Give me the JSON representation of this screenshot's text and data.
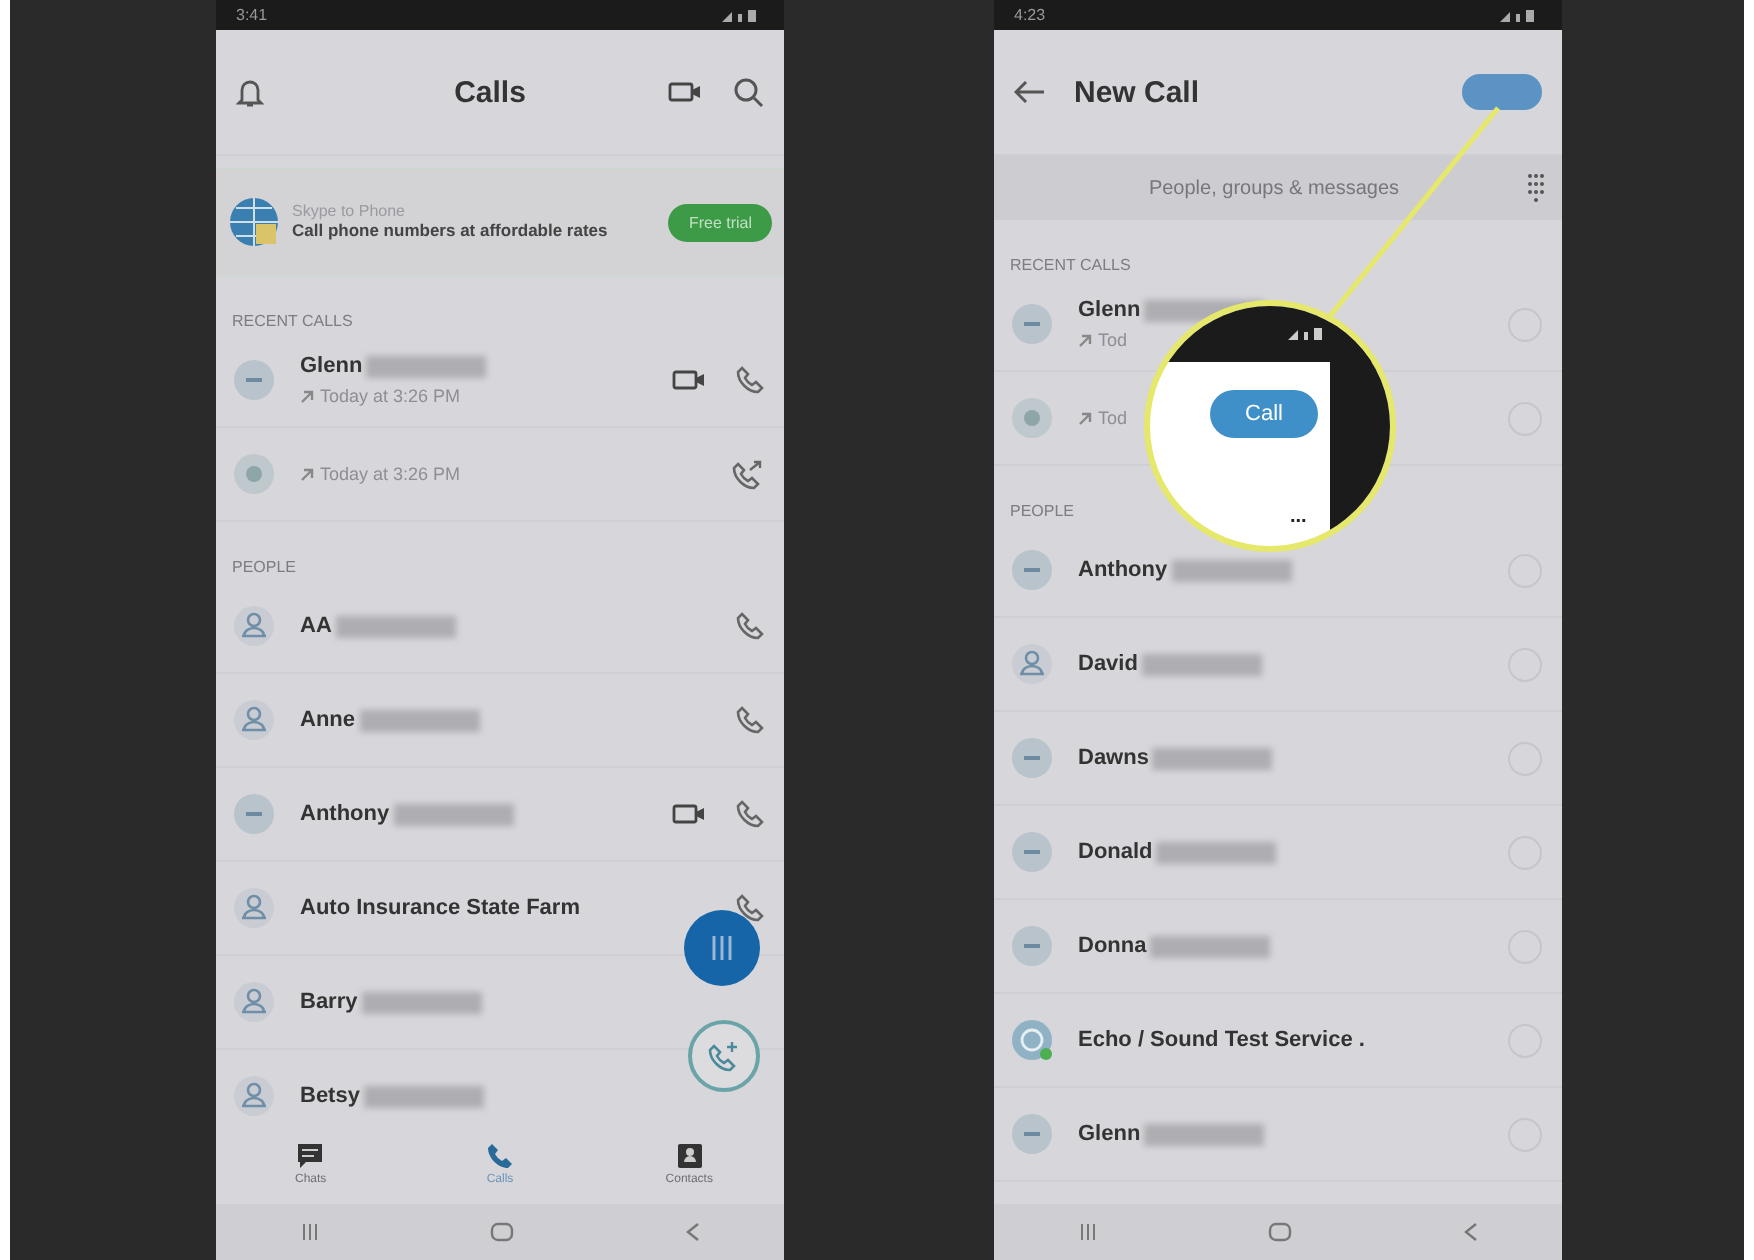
{
  "left_phone": {
    "status_bar": {
      "time": "3:41"
    },
    "header": {
      "title": "Calls"
    },
    "promo": {
      "title": "Skype to Phone",
      "text": "Call phone numbers at affordable rates",
      "button": "Free trial"
    },
    "sections": [
      {
        "heading": "RECENT CALLS",
        "items": [
          {
            "kind": "initials",
            "name": "Glenn",
            "redacted": true,
            "subtitle": "Today at 3:26 PM",
            "actions": [
              {
                "kind": "video"
              },
              {
                "kind": "call"
              }
            ]
          },
          {
            "kind": "globe",
            "subtitle": "Today at 3:26 PM",
            "actions": [
              {
                "kind": "callback"
              }
            ]
          }
        ]
      },
      {
        "heading": "PEOPLE",
        "items": [
          {
            "kind": "person",
            "name": "AA",
            "redacted": true,
            "actions": [
              {
                "kind": "call"
              }
            ]
          },
          {
            "kind": "person",
            "name": "Anne",
            "redacted": true,
            "actions": [
              {
                "kind": "call"
              }
            ]
          },
          {
            "kind": "initials",
            "name": "Anthony",
            "redacted": true,
            "actions": [
              {
                "kind": "video"
              },
              {
                "kind": "call"
              }
            ]
          },
          {
            "kind": "person",
            "name": "Auto Insurance State Farm",
            "redacted": false,
            "actions": [
              {
                "kind": "call"
              }
            ]
          },
          {
            "kind": "person",
            "name": "Barry",
            "redacted": true
          },
          {
            "kind": "person",
            "name": "Betsy",
            "redacted": true
          }
        ]
      }
    ],
    "bottom_nav": [
      {
        "label": "Chats",
        "selected": false
      },
      {
        "label": "Calls",
        "selected": true
      },
      {
        "label": "Contacts",
        "selected": false
      }
    ]
  },
  "right_phone": {
    "status_bar": {
      "time": "4:23"
    },
    "header": {
      "title": "New Call"
    },
    "search": {
      "placeholder": "People, groups & messages"
    },
    "sections": [
      {
        "heading": "RECENT CALLS",
        "items": [
          {
            "kind": "initials",
            "name": "Glenn",
            "redacted": true,
            "subtitle": "Tod",
            "selected": false
          },
          {
            "kind": "globe",
            "subtitle": "Tod",
            "selected": false
          }
        ]
      },
      {
        "heading": "PEOPLE",
        "items": [
          {
            "kind": "initials",
            "name": "Anthony",
            "redacted": true,
            "selected": false
          },
          {
            "kind": "person",
            "name": "David",
            "redacted": true,
            "selected": false
          },
          {
            "kind": "initials",
            "name": "Dawns",
            "redacted": true,
            "selected": false
          },
          {
            "kind": "initials",
            "name": "Donald",
            "redacted": true,
            "selected": false
          },
          {
            "kind": "initials",
            "name": "Donna",
            "redacted": true,
            "selected": false
          },
          {
            "kind": "echo",
            "name": "Echo / Sound Test Service .",
            "redacted": false,
            "selected": false
          },
          {
            "kind": "initials",
            "name": "Glenn",
            "redacted": true,
            "selected": false
          }
        ]
      }
    ],
    "magnifier": {
      "button": "Call",
      "more": "..."
    }
  }
}
